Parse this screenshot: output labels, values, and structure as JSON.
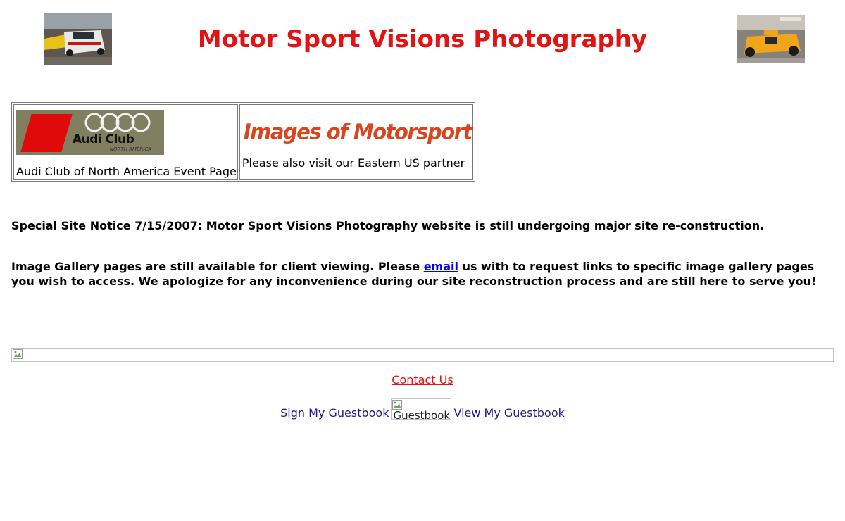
{
  "header": {
    "title": "Motor Sport Visions Photography",
    "left_photo": "race-car-photo",
    "right_photo": "race-car-photo"
  },
  "partners": {
    "audi": {
      "logo_text": "Audi Club",
      "logo_subtext": "NORTH AMERICA",
      "caption": "Audi Club of North America Event Page"
    },
    "motorsport": {
      "logo_text": "Images of Motorsport",
      "caption": "Please also visit our Eastern US partner"
    }
  },
  "notices": {
    "notice_1": "Special Site Notice 7/15/2007: Motor Sport Visions Photography website is still undergoing major site re-construction.",
    "notice_2_before": "Image Gallery pages are still available for client viewing. Please ",
    "notice_2_link": "email",
    "notice_2_after": " us with to request links to specific image gallery pages you wish to access. We apologize for any inconvenience during our site reconstruction process and are still here to serve you!"
  },
  "footer": {
    "contact_label": "Contact Us",
    "sign_guestbook_label": "Sign My Guestbook",
    "guestbook_img_alt": "Guestbook",
    "view_guestbook_label": "View My Guestbook"
  },
  "colors": {
    "title": "#e41313",
    "link": "#0000ee",
    "guestbook_link": "#1a1a8c",
    "motorsport_logo": "#d8461f",
    "audi_red": "#e00a0a"
  }
}
